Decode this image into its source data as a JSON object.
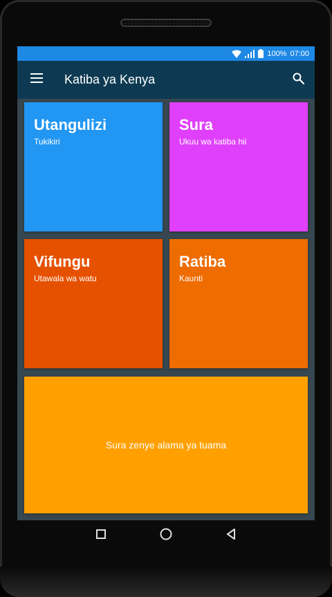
{
  "status_bar": {
    "battery": "100%",
    "time": "07:00",
    "icons": [
      "wifi-icon",
      "signal-icon",
      "battery-icon"
    ]
  },
  "app_bar": {
    "title": "Katiba ya Kenya",
    "menu_icon": "hamburger-menu-icon",
    "search_icon": "search-icon"
  },
  "tiles": [
    {
      "title": "Utangulizi",
      "subtitle": "Tukikiri",
      "color": "#2196f3"
    },
    {
      "title": "Sura",
      "subtitle": "Ukuu wa katiba hii",
      "color": "#e040fb"
    },
    {
      "title": "Vifungu",
      "subtitle": "Utawala wa watu",
      "color": "#e65100"
    },
    {
      "title": "Ratiba",
      "subtitle": "Kaunti",
      "color": "#ef6c00"
    }
  ],
  "bookmarks_tile": {
    "label": "Sura zenye alama ya tuama",
    "color": "#ffa000"
  },
  "nav_bar": {
    "icons": [
      "recent-apps-icon",
      "home-icon",
      "back-icon"
    ]
  },
  "colors": {
    "status_bar": "#1e88e5",
    "app_bar": "#0d3a52",
    "background": "#37474f"
  }
}
